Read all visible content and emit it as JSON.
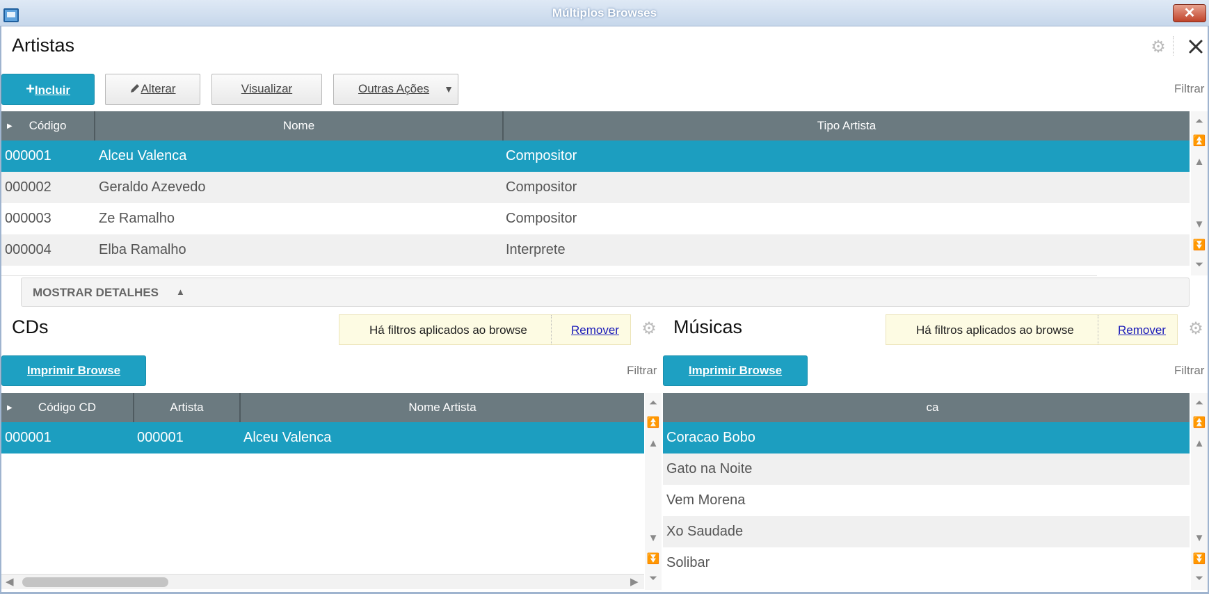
{
  "window": {
    "title": "Múltiplos Browses",
    "close_glyph": "✕"
  },
  "artistas": {
    "title": "Artistas",
    "buttons": {
      "incluir": "Incluir",
      "alterar": "Alterar",
      "visualizar": "Visualizar",
      "outras_acoes": "Outras Ações"
    },
    "filtrar": "Filtrar",
    "columns": [
      "Código",
      "Nome",
      "Tipo Artista"
    ],
    "rows": [
      {
        "codigo": "000001",
        "nome": "Alceu Valenca",
        "tipo": "Compositor"
      },
      {
        "codigo": "000002",
        "nome": "Geraldo Azevedo",
        "tipo": "Compositor"
      },
      {
        "codigo": "000003",
        "nome": "Ze Ramalho",
        "tipo": "Compositor"
      },
      {
        "codigo": "000004",
        "nome": "Elba Ramalho",
        "tipo": "Interprete"
      }
    ],
    "selected_row": 0
  },
  "mostrar_detalhes": {
    "label": "MOSTRAR DETALHES",
    "arrow": "▲"
  },
  "cds": {
    "title": "CDs",
    "notice": "Há filtros aplicados ao browse",
    "remover": "Remover",
    "print_button": "Imprimir Browse",
    "filtrar": "Filtrar",
    "columns": [
      "Código CD",
      "Artista",
      "Nome Artista"
    ],
    "rows": [
      {
        "codigo_cd": "000001",
        "artista": "000001",
        "nome_artista": "Alceu Valenca"
      }
    ]
  },
  "musicas": {
    "title": "Músicas",
    "notice": "Há filtros aplicados ao browse",
    "remover": "Remover",
    "print_button": "Imprimir Browse",
    "filtrar": "Filtrar",
    "columns": [
      "ca"
    ],
    "rows": [
      "Coracao Bobo",
      "Gato na Noite",
      "Vem Morena",
      "Xo Saudade",
      "Solibar"
    ]
  },
  "colors": {
    "accent": "#1ea0c2",
    "selected_row": "#1c9ec0",
    "header": "#6b7a80",
    "notice_bg": "#fdfbe3"
  },
  "icons": [
    "app-icon",
    "gear-icon",
    "close-icon",
    "plus-icon",
    "pencil-icon",
    "dropdown-arrow-icon",
    "scroll-arrow-icon"
  ]
}
